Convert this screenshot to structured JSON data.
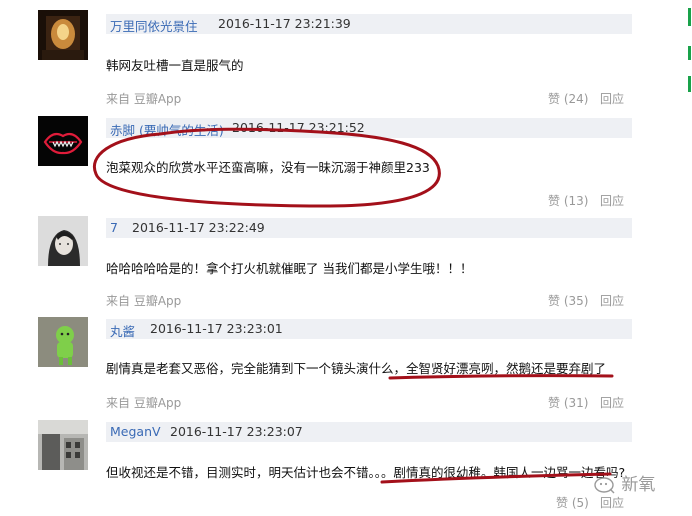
{
  "comments": [
    {
      "username": "万里同依光景住",
      "time": "2016-11-17 23:21:39",
      "text": "韩网友吐槽一直是服气的",
      "source": "来自 豆瓣App",
      "likes": "赞 (24)",
      "reply": "回应"
    },
    {
      "username": "赤脚 (要帅气的生活)",
      "time": "2016-11-17 23:21:52",
      "text": "泡菜观众的欣赏水平还蛮高嘛，没有一昧沉溺于神颜里233",
      "source": "",
      "likes": "赞 (13)",
      "reply": "回应"
    },
    {
      "username": "7",
      "time": "2016-11-17 23:22:49",
      "text": "哈哈哈哈哈是的！拿个打火机就催眠了 当我们都是小学生哦！！！",
      "source": "来自 豆瓣App",
      "likes": "赞 (35)",
      "reply": "回应"
    },
    {
      "username": "丸酱",
      "time": "2016-11-17 23:23:01",
      "text": "剧情真是老套又恶俗，完全能猜到下一个镜头演什么，全智贤好漂亮咧，然鹅还是要弃剧了",
      "source": "来自 豆瓣App",
      "likes": "赞 (31)",
      "reply": "回应"
    },
    {
      "username": "MeganV",
      "time": "2016-11-17 23:23:07",
      "text": "但收视还是不错，目测实时，明天估计也会不错。。。剧情真的很幼稚。韩国人一边骂一边看吗?",
      "source": "",
      "likes": "赞 (5)",
      "reply": "回应"
    }
  ],
  "watermark": "新氧",
  "colors": {
    "username": "#3a6ab5",
    "meta_bg": "#eef0f4",
    "annotation_red": "#a3101a",
    "side_green": "#19a24a"
  }
}
